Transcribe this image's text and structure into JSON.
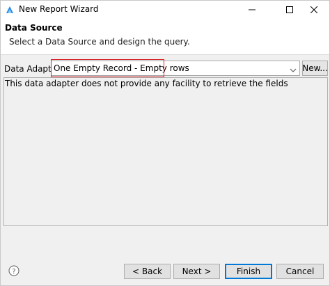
{
  "window": {
    "title": "New Report Wizard",
    "icon": "jaspersoft-app-icon",
    "controls": [
      "minimize-icon",
      "maximize-icon",
      "close-icon"
    ]
  },
  "banner": {
    "title": "Data Source",
    "description": "Select a Data Source and design the query."
  },
  "adapter": {
    "label": "Data Adapter",
    "selected": "One Empty Record - Empty rows",
    "new_label": "New..."
  },
  "content": {
    "message": "This data adapter does not provide any facility to retrieve the fields"
  },
  "footer": {
    "help_icon": "help-icon",
    "back_label": "< Back",
    "next_label": "Next >",
    "finish_label": "Finish",
    "cancel_label": "Cancel"
  },
  "colors": {
    "highlight": "#d9262b",
    "default_button_border": "#0078d7"
  }
}
